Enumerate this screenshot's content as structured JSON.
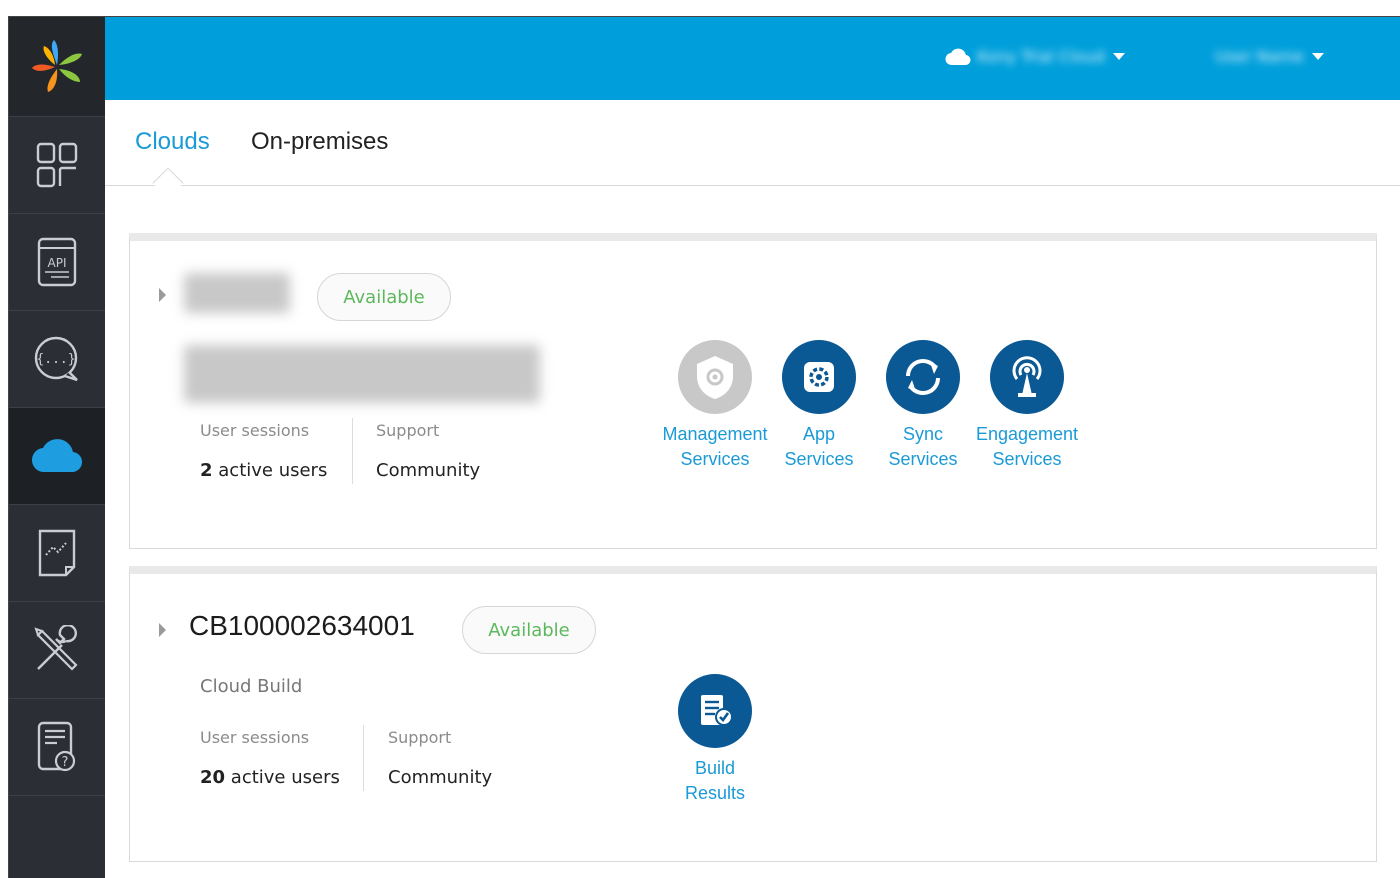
{
  "sidebar": {
    "items": [
      {
        "name": "logo",
        "icon": "pinwheel-logo-icon"
      },
      {
        "name": "apps",
        "icon": "apps-grid-icon"
      },
      {
        "name": "api",
        "icon": "api-document-icon",
        "label": "API"
      },
      {
        "name": "messaging",
        "icon": "chat-bubble-icon"
      },
      {
        "name": "clouds",
        "icon": "cloud-icon",
        "active": true
      },
      {
        "name": "analytics",
        "icon": "analytics-chart-icon"
      },
      {
        "name": "tools",
        "icon": "wrench-screwdriver-icon"
      },
      {
        "name": "help",
        "icon": "help-document-icon"
      }
    ]
  },
  "header": {
    "account_label": "Kony Trial Cloud",
    "user_label": "User Name"
  },
  "tabs": [
    {
      "label": "Clouds",
      "active": true
    },
    {
      "label": "On-premises",
      "active": false
    }
  ],
  "clouds": [
    {
      "name": "",
      "status": "Available",
      "description": "",
      "sessions_label": "User sessions",
      "sessions_count": "2",
      "sessions_suffix": "active users",
      "support_label": "Support",
      "support_value": "Community",
      "services": [
        {
          "line1": "Management",
          "line2": "Services",
          "icon": "management-shield-icon",
          "enabled": false
        },
        {
          "line1": "App",
          "line2": "Services",
          "icon": "app-services-gear-icon",
          "enabled": true
        },
        {
          "line1": "Sync",
          "line2": "Services",
          "icon": "sync-arrows-icon",
          "enabled": true
        },
        {
          "line1": "Engagement",
          "line2": "Services",
          "icon": "broadcast-antenna-icon",
          "enabled": true
        }
      ]
    },
    {
      "name": "CB100002634001",
      "status": "Available",
      "description": "Cloud Build",
      "sessions_label": "User sessions",
      "sessions_count": "20",
      "sessions_suffix": "active users",
      "support_label": "Support",
      "support_value": "Community",
      "services": [
        {
          "line1": "Build",
          "line2": "Results",
          "icon": "build-results-checklist-icon",
          "enabled": true
        }
      ]
    }
  ],
  "colors": {
    "header_blue": "#009fdb",
    "sidebar": "#2b2f35",
    "service_blue": "#0a5894",
    "link_blue": "#1a9ad6",
    "available_green": "#5cb85c"
  }
}
